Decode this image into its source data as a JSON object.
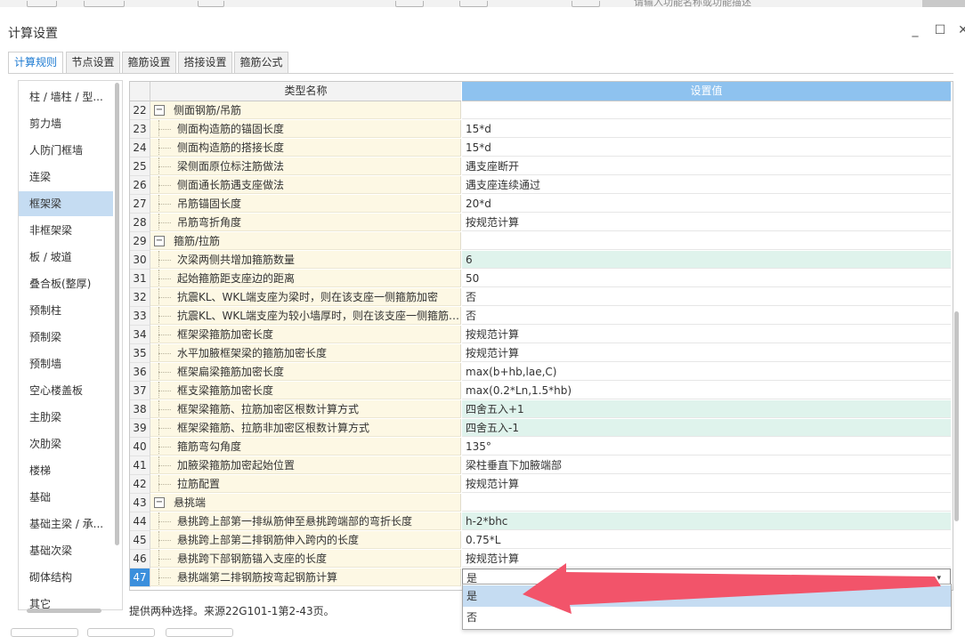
{
  "top_hint": "请输入功能名称或功能描述",
  "window": {
    "title": "计算设置",
    "minimize_label": "_",
    "maximize_label": "☐",
    "close_label": "✕"
  },
  "tabs": [
    {
      "label": "计算规则",
      "active": true
    },
    {
      "label": "节点设置",
      "active": false
    },
    {
      "label": "箍筋设置",
      "active": false
    },
    {
      "label": "搭接设置",
      "active": false
    },
    {
      "label": "箍筋公式",
      "active": false
    }
  ],
  "sidebar": {
    "selected": "框架梁",
    "items": [
      "柱 / 墙柱 / 型...",
      "剪力墙",
      "人防门框墙",
      "连梁",
      "框架梁",
      "非框架梁",
      "板 / 坡道",
      "叠合板(整厚)",
      "预制柱",
      "预制梁",
      "预制墙",
      "空心楼盖板",
      "主肋梁",
      "次肋梁",
      "楼梯",
      "基础",
      "基础主梁 / 承...",
      "基础次梁",
      "砌体结构",
      "其它"
    ]
  },
  "grid": {
    "col_name": "类型名称",
    "col_value": "设置值",
    "toggle_symbol": "−",
    "dropdown_arrow": "▾",
    "rows": [
      {
        "num": "22",
        "name": "侧面钢筋/吊筋",
        "value": "",
        "group": true
      },
      {
        "num": "23",
        "name": "侧面构造筋的锚固长度",
        "value": "15*d"
      },
      {
        "num": "24",
        "name": "侧面构造筋的搭接长度",
        "value": "15*d"
      },
      {
        "num": "25",
        "name": "梁侧面原位标注筋做法",
        "value": "遇支座断开"
      },
      {
        "num": "26",
        "name": "侧面通长筋遇支座做法",
        "value": "遇支座连续通过"
      },
      {
        "num": "27",
        "name": "吊筋锚固长度",
        "value": "20*d"
      },
      {
        "num": "28",
        "name": "吊筋弯折角度",
        "value": "按规范计算"
      },
      {
        "num": "29",
        "name": "箍筋/拉筋",
        "value": "",
        "group": true
      },
      {
        "num": "30",
        "name": "次梁两侧共增加箍筋数量",
        "value": "6",
        "green": true
      },
      {
        "num": "31",
        "name": "起始箍筋距支座边的距离",
        "value": "50"
      },
      {
        "num": "32",
        "name": "抗震KL、WKL端支座为梁时，则在该支座一侧箍筋加密",
        "value": "否"
      },
      {
        "num": "33",
        "name": "抗震KL、WKL端支座为较小墙厚时，则在该支座一侧箍筋加密",
        "value": "否"
      },
      {
        "num": "34",
        "name": "框架梁箍筋加密长度",
        "value": "按规范计算"
      },
      {
        "num": "35",
        "name": "水平加腋框架梁的箍筋加密长度",
        "value": "按规范计算"
      },
      {
        "num": "36",
        "name": "框架扁梁箍筋加密长度",
        "value": "max(b+hb,lae,C)"
      },
      {
        "num": "37",
        "name": "框支梁箍筋加密长度",
        "value": "max(0.2*Ln,1.5*hb)"
      },
      {
        "num": "38",
        "name": "框架梁箍筋、拉筋加密区根数计算方式",
        "value": "四舍五入+1",
        "green": true
      },
      {
        "num": "39",
        "name": "框架梁箍筋、拉筋非加密区根数计算方式",
        "value": "四舍五入-1",
        "green": true
      },
      {
        "num": "40",
        "name": "箍筋弯勾角度",
        "value": "135°"
      },
      {
        "num": "41",
        "name": "加腋梁箍筋加密起始位置",
        "value": "梁柱垂直下加腋端部"
      },
      {
        "num": "42",
        "name": "拉筋配置",
        "value": "按规范计算"
      },
      {
        "num": "43",
        "name": "悬挑端",
        "value": "",
        "group": true
      },
      {
        "num": "44",
        "name": "悬挑跨上部第一排纵筋伸至悬挑跨端部的弯折长度",
        "value": "h-2*bhc",
        "green": true
      },
      {
        "num": "45",
        "name": "悬挑跨上部第二排钢筋伸入跨内的长度",
        "value": "0.75*L"
      },
      {
        "num": "46",
        "name": "悬挑跨下部钢筋锚入支座的长度",
        "value": "按规范计算"
      },
      {
        "num": "47",
        "name": "悬挑端第二排钢筋按弯起钢筋计算",
        "value": "是",
        "selected": true
      }
    ]
  },
  "dropdown": {
    "options": [
      "是",
      "否"
    ],
    "highlighted": "是"
  },
  "description": "提供两种选择。来源22G101-1第2-43页。",
  "colors": {
    "accent_blue": "#1e7bd2",
    "header_value_bg": "#8ec2ef",
    "name_cell_bg": "#fdf8e4",
    "modified_value_bg": "#dff3ec",
    "selection_bg": "#c5dcf2",
    "annotation_arrow": "#f2546a"
  }
}
